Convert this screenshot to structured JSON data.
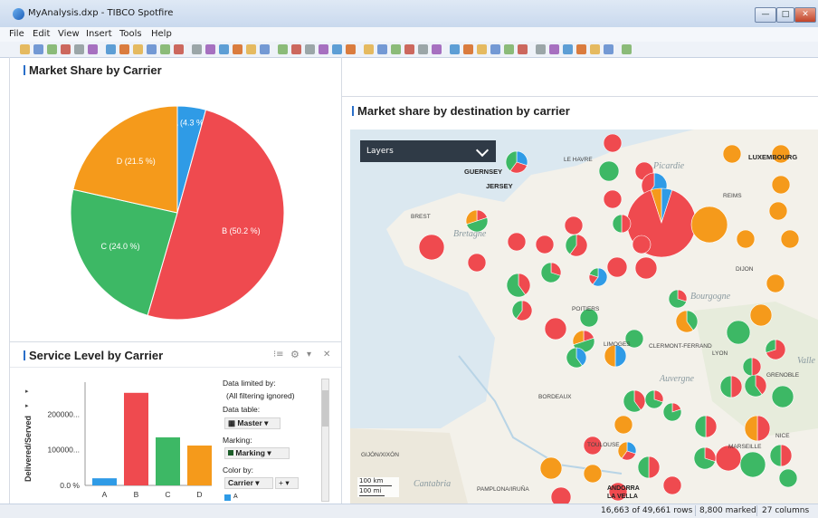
{
  "window": {
    "title": "MyAnalysis.dxp - TIBCO Spotfire",
    "minimize_label": "—",
    "maximize_label": "□",
    "close_label": "✕"
  },
  "menu": [
    "File",
    "Edit",
    "View",
    "Insert",
    "Tools",
    "Help"
  ],
  "panels": {
    "pie_title": "Market Share by Carrier",
    "bar_title": "Service Level by Carrier",
    "map_title": "Market share by destination by carrier"
  },
  "bar_panel": {
    "settings_glyph": "⚙",
    "menu_glyph": "▾",
    "close_glyph": "✕",
    "list_glyph": "⁝≡",
    "data_limited_label": "Data limited by:",
    "data_limited_value": "(All filtering ignored)",
    "data_table_label": "Data table:",
    "data_table_value": "Master",
    "marking_label": "Marking:",
    "marking_value": "Marking",
    "color_by_label": "Color by:",
    "color_by_value": "Carrier",
    "color_swatch_label": "A",
    "plus_glyph": "+"
  },
  "map": {
    "layers_label": "Layers",
    "scale_km": "100 km",
    "scale_mi": "100 mi",
    "labels": {
      "guernsey": "GUERNSEY",
      "jersey": "JERSEY",
      "luxembourg": "LUXEMBOURG",
      "picardie": "Picardie",
      "bretagne": "Bretagne",
      "bourgogne": "Bourgogne",
      "auvergne": "Auvergne",
      "cantabria": "Cantabria",
      "valle": "Valle",
      "le_havre": "LE HAVRE",
      "brest": "BREST",
      "poitiers": "POITIERS",
      "limoges": "LIMOGES",
      "clermont": "CLERMONT-FERRAND",
      "grenoble": "GRENOBLE",
      "dijon": "DIJON",
      "bordeaux": "BORDEAUX",
      "gijon": "GIJÓN/XIXÓN",
      "pamplona": "PAMPLONA/IRUÑA",
      "andorra": "ANDORRA LA VELLA",
      "marseille": "MARSEILLE",
      "nice": "NICE",
      "lyon": "LYON",
      "toulouse": "TOULOUSE",
      "reims": "REIMS"
    }
  },
  "status": {
    "rows": "16,663 of 49,661 rows",
    "marked": "8,800 marked",
    "columns": "27 columns"
  },
  "colors": {
    "A": "#2f9be6",
    "B": "#ef4a4f",
    "C": "#3db865",
    "D": "#f59a1b"
  },
  "chart_data": [
    {
      "type": "pie",
      "title": "Market Share by Carrier",
      "categories": [
        "A",
        "B",
        "C",
        "D"
      ],
      "values": [
        4.3,
        50.2,
        24.0,
        21.5
      ],
      "labels": [
        "A (4.3 %)",
        "B (50.2 %)",
        "C (24.0 %)",
        "D (21.5 %)"
      ]
    },
    {
      "type": "bar",
      "title": "Service Level by Carrier",
      "categories": [
        "A",
        "B",
        "C",
        "D"
      ],
      "values": [
        20000,
        260000,
        135000,
        112000
      ],
      "ylabel": "Delivered/Served",
      "yticks": [
        "0.0 %",
        "100000...",
        "200000..."
      ],
      "ytick_values": [
        0,
        100000,
        200000
      ],
      "ylim": [
        0,
        290000
      ]
    }
  ]
}
